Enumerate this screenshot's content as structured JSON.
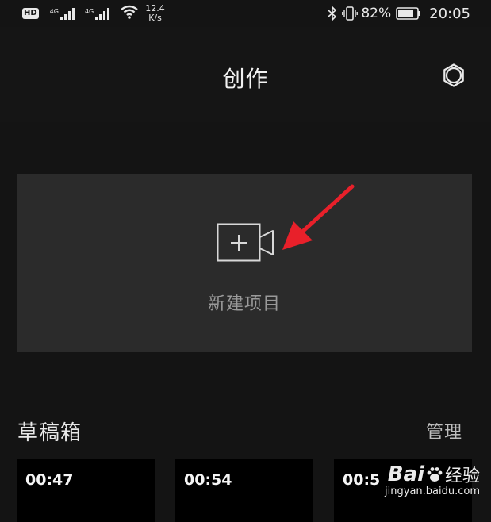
{
  "status_bar": {
    "hd_label": "HD",
    "signal_tag_1": "4G",
    "signal_tag_2": "4G",
    "speed_value": "12.4",
    "speed_unit": "K/s",
    "battery_percent": "82%",
    "time": "20:05",
    "icons": [
      "hd-icon",
      "signal-icon",
      "wifi-icon",
      "bluetooth-icon",
      "vibrate-icon",
      "battery-icon"
    ]
  },
  "header": {
    "title": "创作",
    "settings_icon": "gear-icon"
  },
  "new_project": {
    "label": "新建项目",
    "icon": "add-video-icon",
    "annotation": "red-arrow"
  },
  "drafts": {
    "title": "草稿箱",
    "manage_label": "管理",
    "items": [
      {
        "duration": "00:47"
      },
      {
        "duration": "00:54"
      },
      {
        "duration": "00:5"
      }
    ]
  },
  "watermark": {
    "logo_left": "Bai",
    "logo_right": "经验",
    "url": "jingyan.baidu.com"
  },
  "colors": {
    "background": "#141414",
    "card": "#2b2b2b",
    "arrow": "#e8202a",
    "thumb": "#000000"
  }
}
